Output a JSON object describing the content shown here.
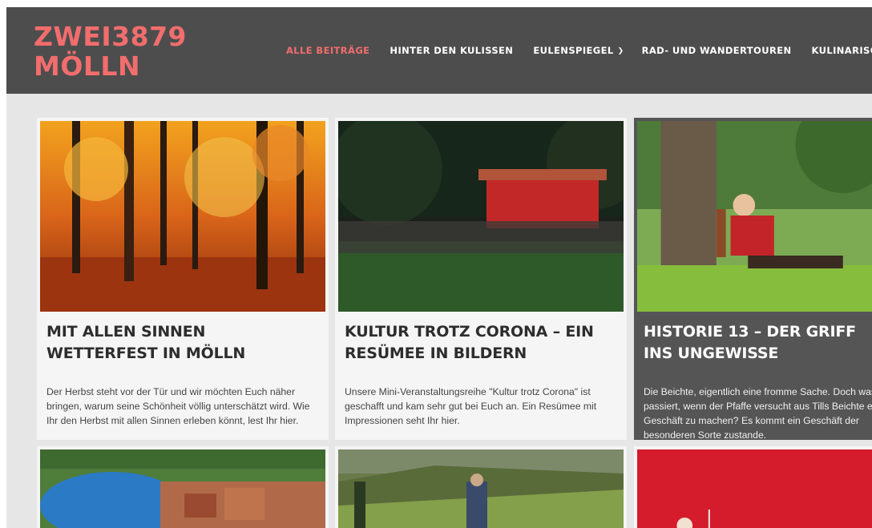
{
  "site": {
    "logo_line1": "ZWEI3879",
    "logo_line2": "MÖLLN"
  },
  "nav": {
    "items": [
      {
        "label": "ALLE BEITRÄGE",
        "active": true
      },
      {
        "label": "HINTER DEN KULISSEN"
      },
      {
        "label": "EULENSPIEGEL",
        "has_dropdown": true
      },
      {
        "label": "RAD- UND WANDERTOUREN"
      },
      {
        "label": "KULINARISCH"
      }
    ]
  },
  "posts": [
    {
      "title": "MIT ALLEN SINNEN WETTERFEST IN MÖLLN",
      "excerpt": "Der Herbst steht vor der Tür und wir möchten Euch näher bringen, warum seine Schönheit völlig unterschätzt wird. Wie Ihr den Herbst mit allen Sinnen erleben könnt, lest Ihr hier."
    },
    {
      "title": "KULTUR TROTZ CORONA – EIN RESÜMEE IN BILDERN",
      "excerpt": "Unsere Mini-Veranstaltungsreihe \"Kultur trotz Corona\" ist geschafft und kam sehr gut bei Euch an. Ein Resümee mit Impressionen seht Ihr hier."
    },
    {
      "title": "HISTORIE 13 – DER GRIFF INS UNGEWISSE",
      "excerpt": "Die Beichte, eigentlich eine fromme Sache. Doch was passiert, wenn der Pfaffe versucht aus Tills Beichte ein Geschäft zu machen? Es kommt ein Geschäft der besonderen Sorte zustande."
    }
  ],
  "colors": {
    "accent": "#f26d6d",
    "header_bg": "#4d4d4d",
    "page_bg": "#e6e6e6",
    "card_bg": "#f5f5f5",
    "card_dark_bg": "#555555"
  }
}
